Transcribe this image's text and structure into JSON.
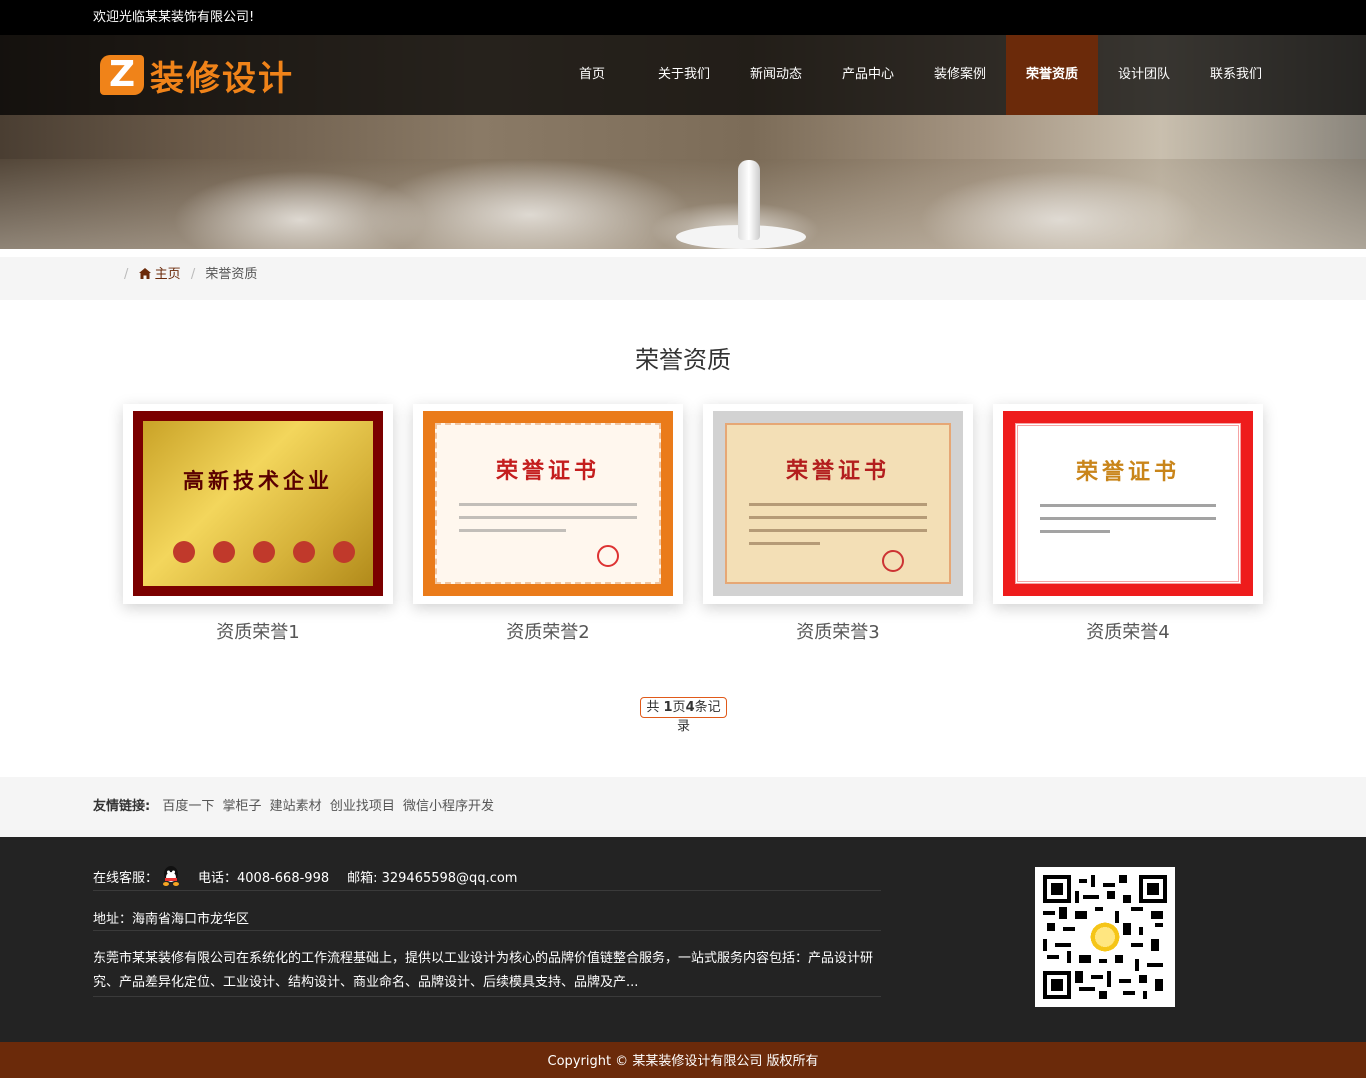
{
  "topbar": {
    "welcome": "欢迎光临某某装饰有限公司!"
  },
  "logo": {
    "mark": "Z",
    "text": "装修设计"
  },
  "nav": [
    {
      "label": "首页",
      "active": false
    },
    {
      "label": "关于我们",
      "active": false
    },
    {
      "label": "新闻动态",
      "active": false
    },
    {
      "label": "产品中心",
      "active": false
    },
    {
      "label": "装修案例",
      "active": false
    },
    {
      "label": "荣誉资质",
      "active": true
    },
    {
      "label": "设计团队",
      "active": false
    },
    {
      "label": "联系我们",
      "active": false
    }
  ],
  "breadcrumb": {
    "home": "主页",
    "current": "荣誉资质"
  },
  "page": {
    "title": "荣誉资质"
  },
  "certificates": [
    {
      "caption": "资质荣誉1",
      "title": "高新技术企业"
    },
    {
      "caption": "资质荣誉2",
      "title": "荣誉证书"
    },
    {
      "caption": "资质荣誉3",
      "title": "荣誉证书"
    },
    {
      "caption": "资质荣誉4",
      "title": "荣誉证书"
    }
  ],
  "pager": {
    "prefix": "共 ",
    "pages": "1",
    "mid": "页",
    "records": "4",
    "suffix": "条记录"
  },
  "links": {
    "label": "友情链接:",
    "items": [
      "百度一下",
      "掌柜子",
      "建站素材",
      "创业找项目",
      "微信小程序开发"
    ]
  },
  "footer": {
    "service_label": "在线客服：",
    "phone": "电话：4008-668-998",
    "email": "邮箱: 329465598@qq.com",
    "address": "地址：海南省海口市龙华区",
    "description": "东莞市某某装修有限公司在系统化的工作流程基础上，提供以工业设计为核心的品牌价值链整合服务，一站式服务内容包括：产品设计研究、产品差异化定位、工业设计、结构设计、商业命名、品牌设计、后续模具支持、品牌及产..."
  },
  "copyright": "Copyright © 某某装修设计有限公司 版权所有",
  "colors": {
    "brand_orange": "#f08319",
    "brand_brown": "#6b2a0a",
    "footer_bg": "#232323"
  }
}
